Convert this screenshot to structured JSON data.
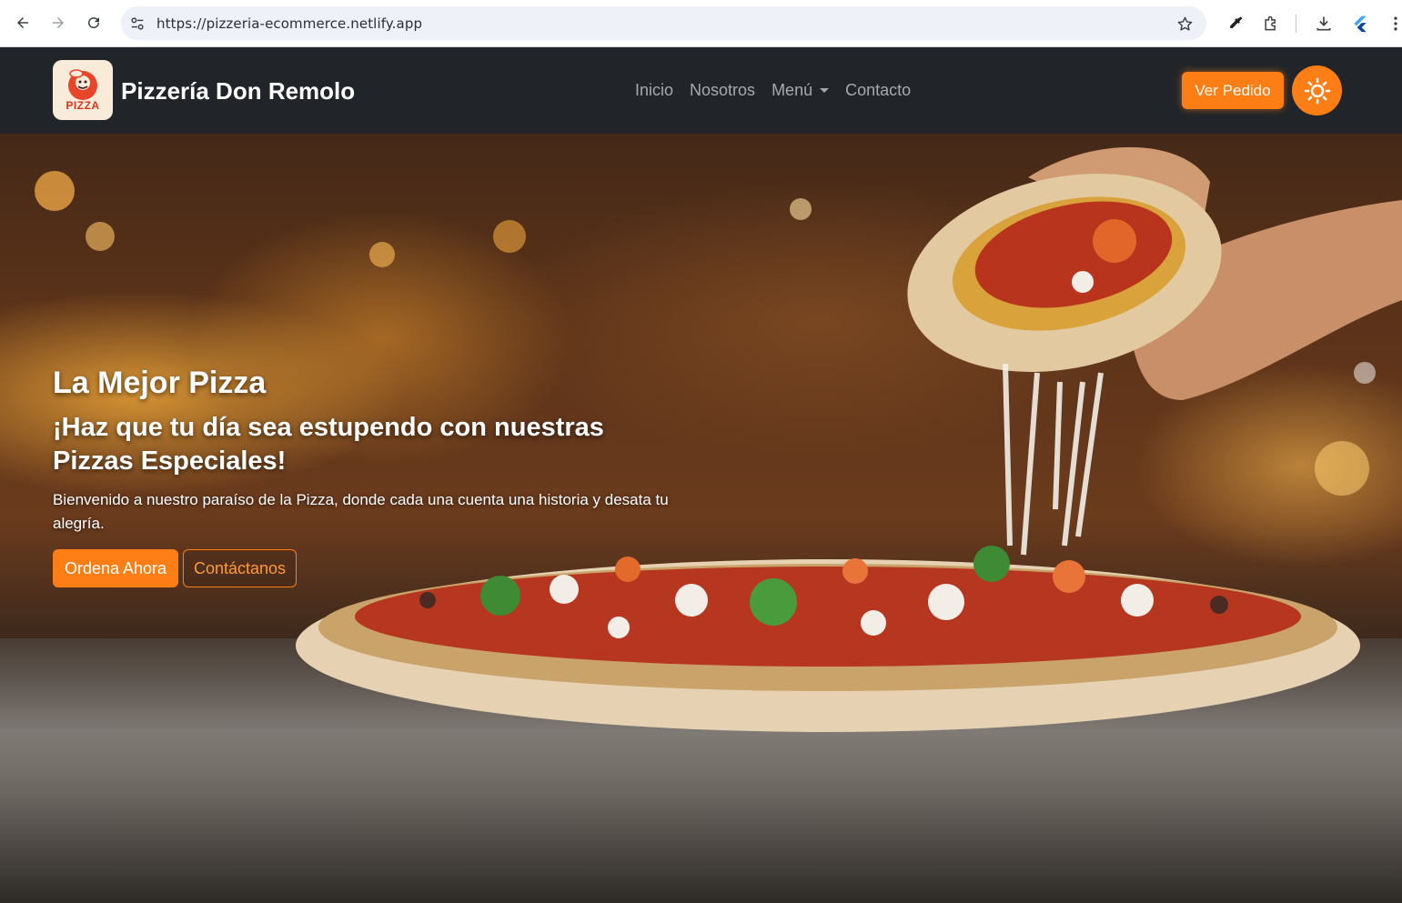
{
  "browser": {
    "url": "https://pizzeria-ecommerce.netlify.app",
    "icons": [
      "back-icon",
      "forward-icon",
      "reload-icon",
      "site-info-icon",
      "bookmark-star-icon",
      "eyedropper-icon",
      "extensions-icon",
      "download-icon",
      "flutter-icon",
      "more-icon"
    ]
  },
  "navbar": {
    "logo_text": "PIZZA",
    "brand": "Pizzería Don Remolo",
    "links": [
      {
        "label": "Inicio"
      },
      {
        "label": "Nosotros"
      },
      {
        "label": "Menú"
      },
      {
        "label": "Contacto"
      }
    ],
    "order_button": "Ver Pedido",
    "theme_icon": "sun-icon"
  },
  "hero": {
    "title": "La Mejor Pizza",
    "subtitle": "¡Haz que tu día sea estupendo con nuestras Pizzas Especiales!",
    "description": "Bienvenido a nuestro paraíso de la Pizza, donde cada una cuenta una historia y desata tu alegría.",
    "primary_cta": "Ordena Ahora",
    "secondary_cta": "Contáctanos"
  },
  "colors": {
    "accent": "#fd7e14",
    "navbar_bg": "#212529"
  }
}
